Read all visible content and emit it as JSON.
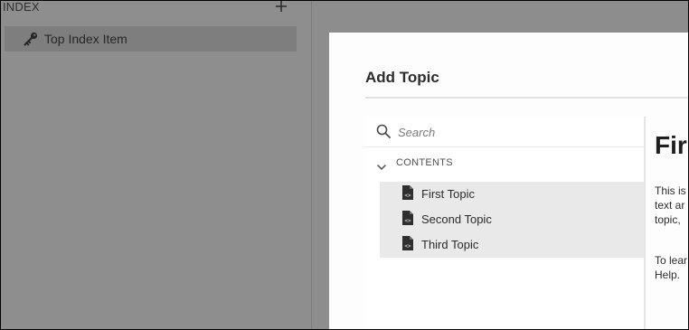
{
  "index_panel": {
    "title": "INDEX",
    "add_icon": "plus-icon",
    "items": [
      {
        "label": "Top Index Item",
        "icon": "key-icon"
      }
    ]
  },
  "dialog": {
    "title": "Add Topic",
    "search": {
      "placeholder": "Search",
      "value": ""
    },
    "contents_label": "CONTENTS",
    "topics": [
      {
        "label": "First Topic",
        "icon": "document-icon"
      },
      {
        "label": "Second Topic",
        "icon": "document-icon"
      },
      {
        "label": "Third Topic",
        "icon": "document-icon"
      }
    ],
    "preview": {
      "title": "Firs",
      "paragraph1_lines": [
        "This is",
        "text ar",
        "topic, "
      ],
      "paragraph2_lines": [
        "To lear",
        "Help."
      ]
    }
  },
  "colors": {
    "overlay": "#8c8c8c",
    "dialog_bg": "#fdfdfd",
    "selection_bg": "#e9e9e9"
  }
}
